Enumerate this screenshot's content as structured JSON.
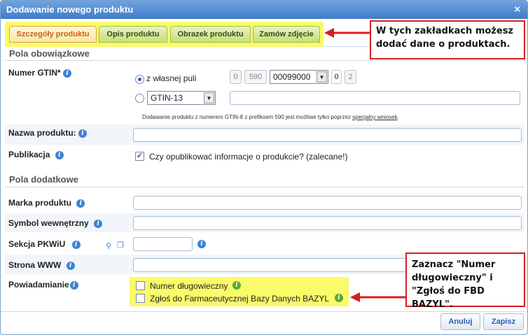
{
  "dialog": {
    "title": "Dodawanie nowego produktu",
    "close_glyph": "×"
  },
  "tabs": [
    {
      "label": "Szczegóły produktu",
      "active": true
    },
    {
      "label": "Opis produktu",
      "active": false
    },
    {
      "label": "Obrazek produktu",
      "active": false
    },
    {
      "label": "Zamów zdjęcie",
      "active": false
    }
  ],
  "callouts": {
    "tabs_note": "W tych zakładkach możesz dodać dane o produktach.",
    "checkbox_note": "Zaznacz \"Numer długowieczny\" i \"Zgłoś do FBD BAZYL\"."
  },
  "sections": {
    "required": "Pola obowiązkowe",
    "additional": "Pola dodatkowe"
  },
  "gtin": {
    "label": "Numer GTIN*",
    "option_own_pool": "z własnej puli",
    "option_own_pool_selected": true,
    "segment_1": "0",
    "segment_2": "590",
    "segment_select": "00099000",
    "segment_3": "0",
    "segment_4": "2",
    "type_select": "GTIN-13",
    "note_prefix": "Dodawanie produktu z numerem GTIN-8 z prefiksem 590 jest możliwe tylko poprzez",
    "note_link": "specjalny wniosek",
    "note_suffix": "."
  },
  "fields": {
    "product_name_label": "Nazwa produktu:",
    "publication_label": "Publikacja",
    "publication_checkbox": "Czy opublikować informacje o produkcie? (zalecane!)",
    "publication_checked": true,
    "brand_label": "Marka produktu",
    "internal_symbol_label": "Symbol wewnętrzny",
    "pkwiu_label": "Sekcja PKWiU",
    "www_label": "Strona WWW",
    "notifications_label": "Powiadamianie",
    "long_life_checkbox": "Numer długowieczny",
    "long_life_checked": false,
    "bazyl_checkbox": "Zgłoś do Farmaceutycznej Bazy Danych BAZYL",
    "bazyl_checked": false
  },
  "buttons": {
    "cancel": "Anuluj",
    "save": "Zapisz"
  },
  "icons": {
    "info": "info-icon",
    "search": "magnifier-icon",
    "copy": "copy-icon",
    "arrow": "red-arrow-icon"
  },
  "colors": {
    "highlight": "#fafa6a",
    "callout_border": "#d42020",
    "active_tab_text": "#d06018",
    "title_bar": "#4f8ad4"
  }
}
